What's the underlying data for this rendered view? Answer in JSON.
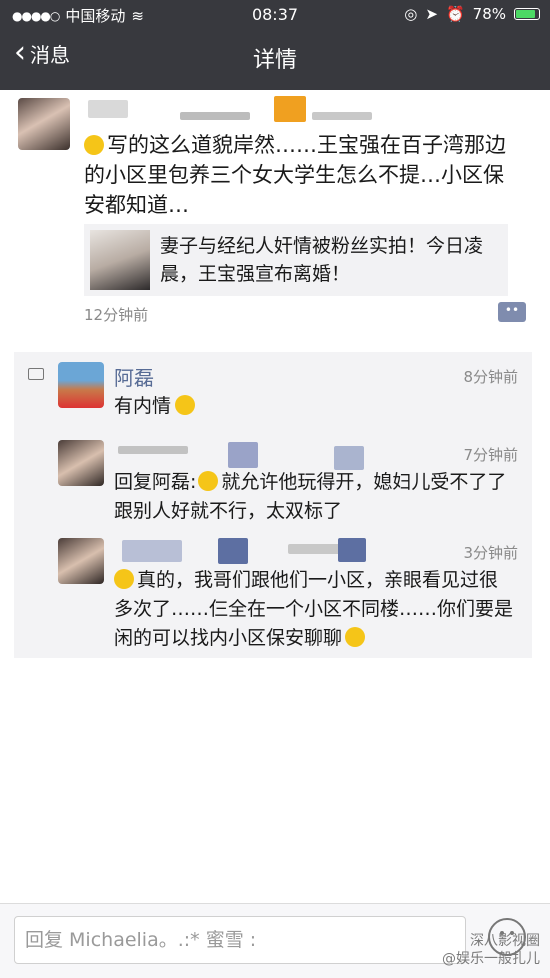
{
  "status_bar": {
    "carrier": "中国移动",
    "time": "08:37",
    "battery_percent": "78%"
  },
  "nav": {
    "back_label": "消息",
    "title": "详情"
  },
  "post": {
    "text": "写的这么道貌岸然……王宝强在百子湾那边的小区里包养三个女大学生怎么不提…小区保安都知道…",
    "link_card_text": "妻子与经纪人奸情被粉丝实拍！今日凌晨，王宝强宣布离婚！",
    "time": "12分钟前"
  },
  "comments": [
    {
      "name": "阿磊",
      "time": "8分钟前",
      "text": "有内情"
    },
    {
      "reply_prefix": "回复阿磊:",
      "time": "7分钟前",
      "text": "就允许他玩得开，媳妇儿受不了了跟别人好就不行，太双标了"
    },
    {
      "time": "3分钟前",
      "text": "真的，我哥们跟他们一小区，亲眼看见过很多次了……仨全在一个小区不同楼……你们要是闲的可以找内小区保安聊聊"
    }
  ],
  "input": {
    "placeholder": "回复 Michaelia。.:*  蜜雪 :"
  },
  "watermark": {
    "line1": "深八影视圈",
    "line2": "@娱乐一般扎儿"
  },
  "colors": {
    "nav_bg": "#38393e",
    "name_blue": "#576b95",
    "panel_bg": "#f3f3f5"
  }
}
